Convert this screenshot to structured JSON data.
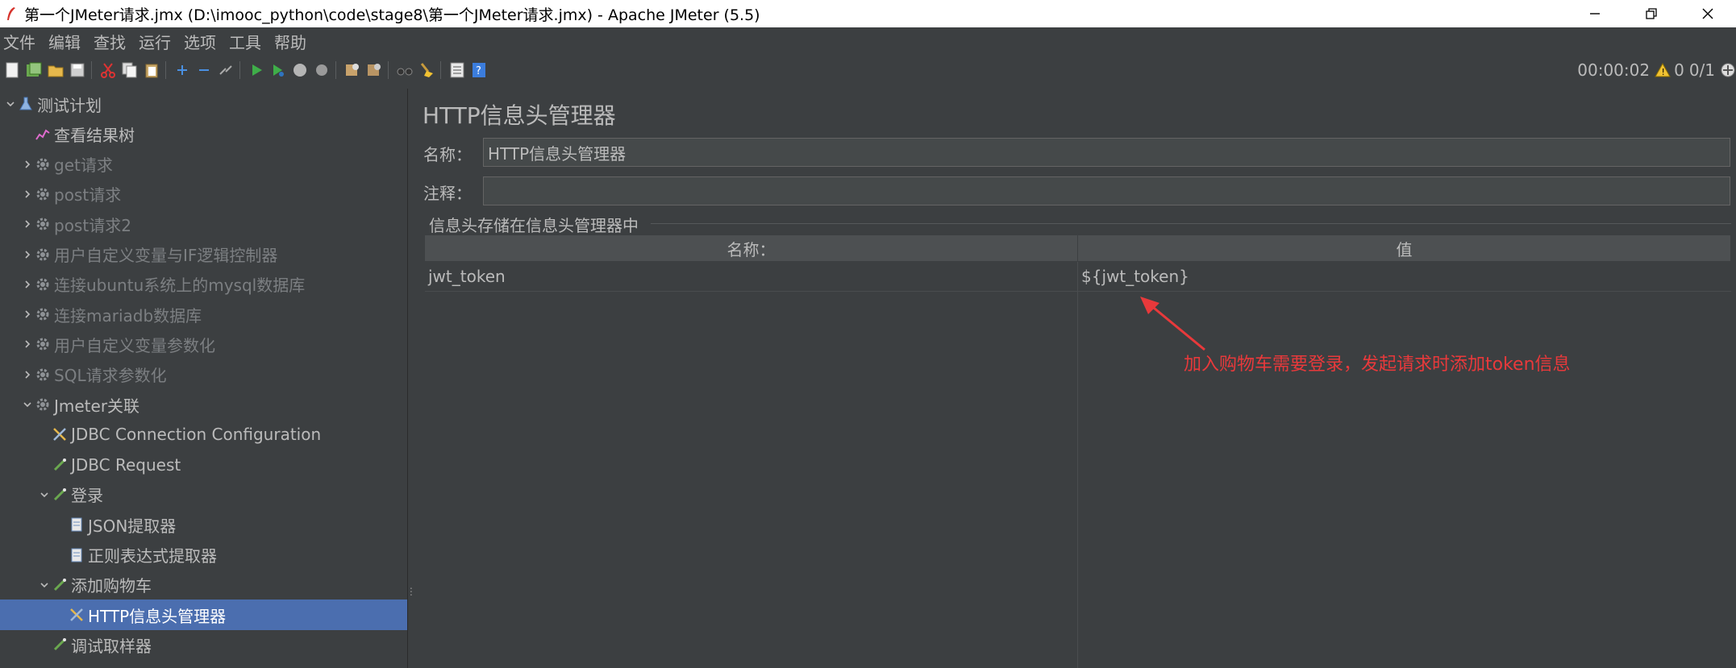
{
  "window": {
    "title": "第一个JMeter请求.jmx (D:\\imooc_python\\code\\stage8\\第一个JMeter请求.jmx) - Apache JMeter (5.5)"
  },
  "menu": [
    "文件",
    "编辑",
    "查找",
    "运行",
    "选项",
    "工具",
    "帮助"
  ],
  "toolbar_status": {
    "elapsed": "00:00:02",
    "warnings": "0",
    "threads": "0/1"
  },
  "tree": [
    {
      "label": "测试计划",
      "expanded": true,
      "disabled": false,
      "selected": false,
      "icon": "test-plan-icon"
    },
    {
      "label": "查看结果树",
      "expanded": null,
      "disabled": false,
      "selected": false,
      "icon": "listener-icon"
    },
    {
      "label": "get请求",
      "expanded": false,
      "disabled": true,
      "selected": false,
      "icon": "gear-icon"
    },
    {
      "label": "post请求",
      "expanded": false,
      "disabled": true,
      "selected": false,
      "icon": "gear-icon"
    },
    {
      "label": "post请求2",
      "expanded": false,
      "disabled": true,
      "selected": false,
      "icon": "gear-icon"
    },
    {
      "label": "用户自定义变量与IF逻辑控制器",
      "expanded": false,
      "disabled": true,
      "selected": false,
      "icon": "gear-icon"
    },
    {
      "label": "连接ubuntu系统上的mysql数据库",
      "expanded": false,
      "disabled": true,
      "selected": false,
      "icon": "gear-icon"
    },
    {
      "label": "连接mariadb数据库",
      "expanded": false,
      "disabled": true,
      "selected": false,
      "icon": "gear-icon"
    },
    {
      "label": "用户自定义变量参数化",
      "expanded": false,
      "disabled": true,
      "selected": false,
      "icon": "gear-icon"
    },
    {
      "label": "SQL请求参数化",
      "expanded": false,
      "disabled": true,
      "selected": false,
      "icon": "gear-icon"
    },
    {
      "label": "Jmeter关联",
      "expanded": true,
      "disabled": false,
      "selected": false,
      "icon": "gear-icon"
    },
    {
      "label": "JDBC Connection Configuration",
      "expanded": null,
      "disabled": false,
      "selected": false,
      "icon": "config-icon"
    },
    {
      "label": "JDBC Request",
      "expanded": null,
      "disabled": false,
      "selected": false,
      "icon": "sampler-icon"
    },
    {
      "label": "登录",
      "expanded": true,
      "disabled": false,
      "selected": false,
      "icon": "sampler-icon"
    },
    {
      "label": "JSON提取器",
      "expanded": null,
      "disabled": false,
      "selected": false,
      "icon": "extractor-icon"
    },
    {
      "label": "正则表达式提取器",
      "expanded": null,
      "disabled": false,
      "selected": false,
      "icon": "extractor-icon"
    },
    {
      "label": "添加购物车",
      "expanded": true,
      "disabled": false,
      "selected": false,
      "icon": "sampler-icon"
    },
    {
      "label": "HTTP信息头管理器",
      "expanded": null,
      "disabled": false,
      "selected": true,
      "icon": "config-icon"
    },
    {
      "label": "调试取样器",
      "expanded": null,
      "disabled": false,
      "selected": false,
      "icon": "sampler-icon"
    }
  ],
  "panel": {
    "title": "HTTP信息头管理器",
    "name_label": "名称：",
    "name_value": "HTTP信息头管理器",
    "comment_label": "注释：",
    "comment_value": "",
    "group_legend": "信息头存储在信息头管理器中",
    "table": {
      "columns": [
        "名称：",
        "值"
      ],
      "rows": [
        {
          "name": "jwt_token",
          "value": "${jwt_token}"
        }
      ]
    },
    "annotation": "加入购物车需要登录，发起请求时添加token信息",
    "annotation_color": "#e8393b"
  },
  "colors": {
    "background": "#3c3f41",
    "selection": "#4b6eaf",
    "text": "#bbbbbb"
  }
}
